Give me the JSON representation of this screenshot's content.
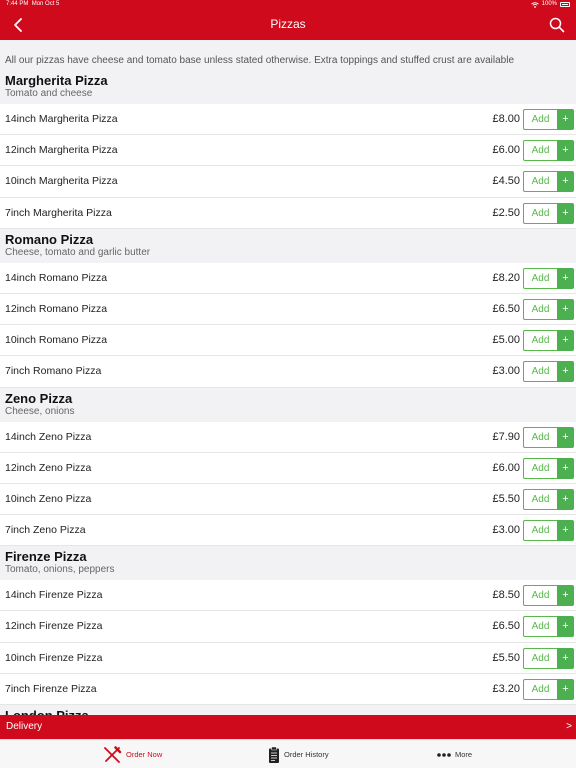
{
  "status_bar": {
    "time": "7:44 PM",
    "date": "Mon Oct 5",
    "battery": "100%"
  },
  "nav": {
    "title": "Pizzas",
    "back_icon": "chevron-left-icon",
    "search_icon": "search-icon"
  },
  "notice": "All our pizzas have cheese and tomato base unless stated otherwise. Extra toppings and stuffed crust are available",
  "add_label": "Add",
  "plus_label": "+",
  "sections": [
    {
      "title": "Margherita Pizza",
      "description": "Tomato and cheese",
      "items": [
        {
          "name": "14inch Margherita Pizza",
          "price": "£8.00"
        },
        {
          "name": "12inch Margherita Pizza",
          "price": "£6.00"
        },
        {
          "name": "10inch Margherita Pizza",
          "price": "£4.50"
        },
        {
          "name": "7inch Margherita Pizza",
          "price": "£2.50"
        }
      ]
    },
    {
      "title": "Romano Pizza",
      "description": "Cheese, tomato and garlic butter",
      "items": [
        {
          "name": "14inch Romano Pizza",
          "price": "£8.20"
        },
        {
          "name": "12inch Romano Pizza",
          "price": "£6.50"
        },
        {
          "name": "10inch Romano Pizza",
          "price": "£5.00"
        },
        {
          "name": "7inch Romano Pizza",
          "price": "£3.00"
        }
      ]
    },
    {
      "title": "Zeno Pizza",
      "description": "Cheese, onions",
      "items": [
        {
          "name": "14inch Zeno Pizza",
          "price": "£7.90"
        },
        {
          "name": "12inch Zeno Pizza",
          "price": "£6.00"
        },
        {
          "name": "10inch Zeno Pizza",
          "price": "£5.50"
        },
        {
          "name": "7inch Zeno Pizza",
          "price": "£3.00"
        }
      ]
    },
    {
      "title": "Firenze Pizza",
      "description": "Tomato, onions, peppers",
      "items": [
        {
          "name": "14inch Firenze Pizza",
          "price": "£8.50"
        },
        {
          "name": "12inch Firenze Pizza",
          "price": "£6.50"
        },
        {
          "name": "10inch Firenze Pizza",
          "price": "£5.50"
        },
        {
          "name": "7inch Firenze Pizza",
          "price": "£3.20"
        }
      ]
    },
    {
      "title": "London Pizza",
      "description": "",
      "items": []
    }
  ],
  "delivery": {
    "label": "Delivery",
    "chevron": ">"
  },
  "tabs": [
    {
      "label": "Order Now",
      "icon": "fork-knife-icon",
      "active": true
    },
    {
      "label": "Order History",
      "icon": "clipboard-icon",
      "active": false
    },
    {
      "label": "More",
      "icon": "more-dots-icon",
      "active": false
    }
  ],
  "colors": {
    "brand_red": "#cf0a1c",
    "add_green": "#4caf50",
    "background": "#f2f2f4"
  }
}
